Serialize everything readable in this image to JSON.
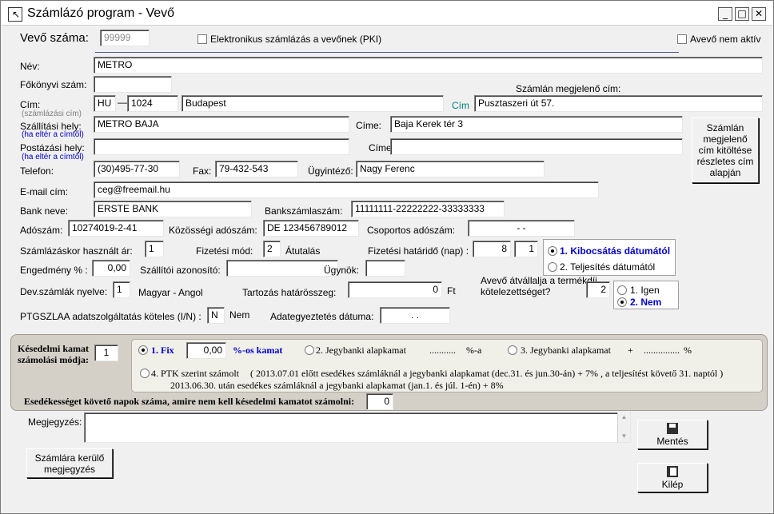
{
  "window": {
    "title": "Számlázó program   -  Vevő",
    "min": "_",
    "max": "□",
    "close": "✕"
  },
  "header": {
    "customer_no_label": "Vevő száma:",
    "customer_no": "99999",
    "einvoice_label": "Elektronikus számlázás a vevőnek (PKI)",
    "inactive_label": "Avevő nem aktív"
  },
  "form": {
    "name_label": "Név:",
    "name": "METRO",
    "ledger_label": "Főkönyvi szám:",
    "ledger": "",
    "invoice_addr_title": "Számlán megjelenő cím:",
    "addr_label": "Cím:",
    "addr_sub": "(számlázási cím)",
    "country": "HU",
    "zip": "1024",
    "city": "Budapest",
    "cim_btn": "Cím",
    "street": "Pusztaszeri út 57.",
    "ship_label": "Szállítási hely:",
    "ship_sub": "(ha eltér a címtől)",
    "ship_name": "METRO BAJA",
    "ship_addr_label": "Címe:",
    "ship_addr": "Baja Kerek tér 3",
    "post_label": "Postázási hely:",
    "post_sub": "(ha eltér a címtől)",
    "post_name": "",
    "post_addr_label": "Címe:",
    "post_addr": "",
    "fill_btn": "Számlán megjelenő cím kitöltése részletes cím alapján",
    "phone_label": "Telefon:",
    "phone": "(30)495-77-30",
    "fax_label": "Fax:",
    "fax": "79-432-543",
    "agent_label": "Ügyintéző:",
    "agent": "Nagy Ferenc",
    "email_label": "E-mail cím:",
    "email": "ceg@freemail.hu",
    "bank_label": "Bank neve:",
    "bank": "ERSTE BANK",
    "account_label": "Bankszámlaszám:",
    "account": "11111111-22222222-33333333",
    "tax_label": "Adószám:",
    "tax": "10274019-2-41",
    "eu_tax_label": "Közösségi adószám:",
    "eu_tax": "DE 123456789012",
    "group_tax_label": "Csoportos adószám:",
    "group_tax": "- -",
    "price_label": "Számlázáskor használt ár:",
    "price": "1",
    "paymode_label": "Fizetési mód:",
    "paymode": "2",
    "paymode_text": "Átutalás",
    "due_label": "Fizetési határidő (nap) :",
    "due_days": "8",
    "due_mode": "1",
    "due_opt1": "1.  Kibocsátás dátumától",
    "due_opt2": "2.  Teljesítés dátumától",
    "discount_label": "Engedmény % :",
    "discount": "0,00",
    "supplier_id_label": "Szállítói azonosító:",
    "supplier_id": "",
    "broker_label": "Ügynök:",
    "broker": "",
    "lang_label": "Dev.számlák nyelve:",
    "lang": "1",
    "lang_text": "Magyar - Angol",
    "debt_label": "Tartozás határösszeg:",
    "debt": "0",
    "debt_unit": "Ft",
    "product_fee_label": "Avevő átvállalja a termékdíj kötelezettséget?",
    "product_fee": "2",
    "fee_yes": "1.  Igen",
    "fee_no": "2.  Nem",
    "ptg_label": "PTGSZLAA adatszolgáltatás köteles (I/N) :",
    "ptg": "N",
    "ptg_text": "Nem",
    "reconcile_label": "Adategyeztetés dátuma:",
    "reconcile": ". ."
  },
  "late": {
    "label": "Késedelmi kamat számolási módja:",
    "mode": "1",
    "opt1": "1.  Fix",
    "fix_value": "0,00",
    "opt1_suffix": "%-os   kamat",
    "opt2": "2.  Jegybanki alapkamat",
    "opt2_dots": "...........",
    "opt2_suffix": "%-a",
    "opt3": "3. Jegybanki alapkamat",
    "opt3_plus": "+",
    "opt3_dots": "...............",
    "opt3_suffix": "%",
    "opt4": "4.   PTK szerint számolt",
    "opt4_line1": "( 2013.07.01 előtt esedékes számláknál a  jegybanki alapkamat (dec.31. és jun.30-án)  + 7% ,  a teljesítést követő 31. naptól )",
    "opt4_line2": "2013.06.30. után esedékes számláknál a  jegybanki alapkamat (jan.1. és júl. 1-én)  + 8%",
    "days_label": "Esedékességet követő napok száma, amire nem kell késedelmi kamatot számolni:",
    "days": "0"
  },
  "notes": {
    "label": "Megjegyzés:",
    "value": "",
    "invoice_note_btn": "Számlára kerülő megjegyzés",
    "save_btn": "Mentés",
    "exit_btn": "Kilép"
  }
}
